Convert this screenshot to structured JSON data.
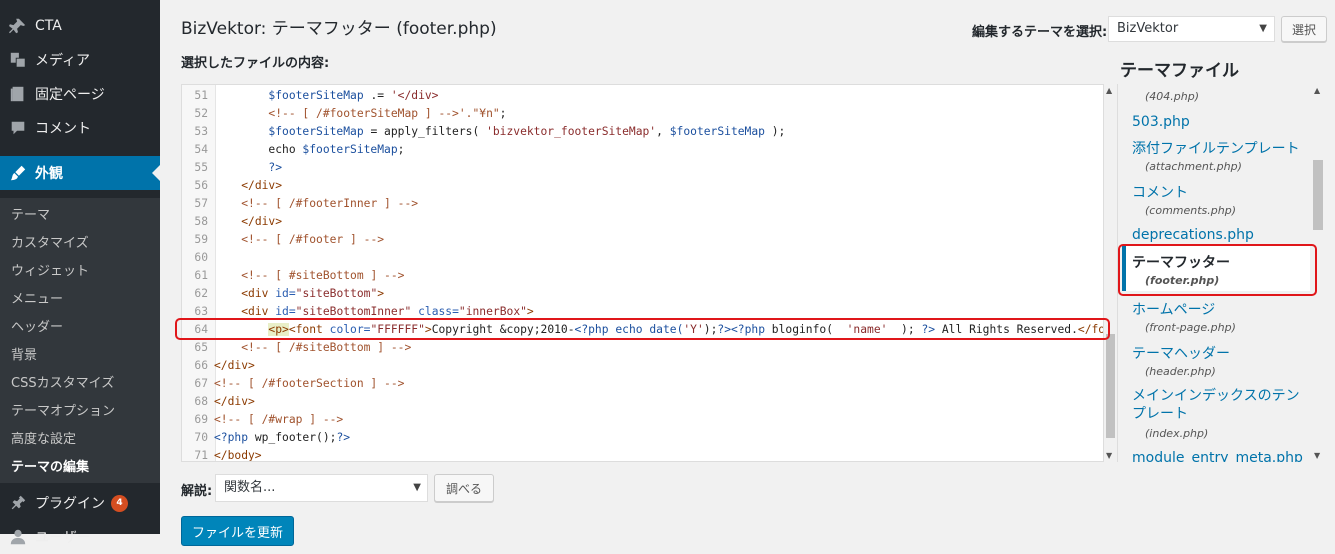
{
  "sidebar": {
    "items": [
      {
        "label": "CTA",
        "icon": "pin-icon"
      },
      {
        "label": "メディア",
        "icon": "media-icon"
      },
      {
        "label": "固定ページ",
        "icon": "page-icon"
      },
      {
        "label": "コメント",
        "icon": "comment-icon"
      },
      {
        "label": "外観",
        "icon": "appearance-icon"
      }
    ],
    "submenu": [
      "テーマ",
      "カスタマイズ",
      "ウィジェット",
      "メニュー",
      "ヘッダー",
      "背景",
      "CSSカスタマイズ",
      "テーマオプション",
      "高度な設定",
      "テーマの編集"
    ],
    "plugins": {
      "label": "プラグイン",
      "badge": "4",
      "icon": "plugin-icon"
    },
    "partial": "ユーザー"
  },
  "header": {
    "title": "BizVektor: テーマフッター (footer.php)",
    "content_label": "選択したファイルの内容:",
    "theme_select_label": "編集するテーマを選択:",
    "theme_select_value": "BizVektor",
    "select_button": "選択"
  },
  "editor": {
    "lines": [
      {
        "n": "51",
        "html": "        <span class=\"v\">$footerSiteMap</span> .= <span class=\"s\">'&lt;/div&gt;</span>"
      },
      {
        "n": "52",
        "html": "        <span class=\"c\">&lt;!-- [ /#footerSiteMap ] --&gt;'.\"¥n\"</span>;"
      },
      {
        "n": "53",
        "html": "        <span class=\"v\">$footerSiteMap</span> = apply_filters( <span class=\"s\">'bizvektor_footerSiteMap'</span>, <span class=\"v\">$footerSiteMap</span> );"
      },
      {
        "n": "54",
        "html": "        echo <span class=\"v\">$footerSiteMap</span>;"
      },
      {
        "n": "55",
        "html": "        <span class=\"p\">?&gt;</span>"
      },
      {
        "n": "56",
        "html": "    <span class=\"t\">&lt;/div&gt;</span>"
      },
      {
        "n": "57",
        "html": "    <span class=\"c\">&lt;!-- [ /#footerInner ] --&gt;</span>"
      },
      {
        "n": "58",
        "html": "    <span class=\"t\">&lt;/div&gt;</span>"
      },
      {
        "n": "59",
        "html": "    <span class=\"c\">&lt;!-- [ /#footer ] --&gt;</span>"
      },
      {
        "n": "60",
        "html": ""
      },
      {
        "n": "61",
        "html": "    <span class=\"c\">&lt;!-- [ #siteBottom ] --&gt;</span>"
      },
      {
        "n": "62",
        "html": "    <span class=\"t\">&lt;div</span> <span class=\"a\">id=</span><span class=\"s\">\"siteBottom\"</span><span class=\"t\">&gt;</span>"
      },
      {
        "n": "63",
        "html": "    <span class=\"t\">&lt;div</span> <span class=\"a\">id=</span><span class=\"s\">\"siteBottomInner\"</span> <span class=\"a\">class=</span><span class=\"s\">\"innerBox\"</span><span class=\"t\">&gt;</span>"
      },
      {
        "n": "64",
        "html": "        <span class=\"t hl-p\">&lt;p&gt;</span><span class=\"t\">&lt;font</span> <span class=\"a\">color=</span><span class=\"s\">\"FFFFFF\"</span><span class=\"t\">&gt;</span>Copyright &amp;copy;2010-<span class=\"p\">&lt;?php</span> <span class=\"v\">echo date(</span><span class=\"s\">'Y'</span>);<span class=\"p\">?&gt;&lt;?php</span> bloginfo(  <span class=\"s\">'name'</span>  ); <span class=\"p\">?&gt;</span> All Rights Reserved.<span class=\"t\">&lt;/font&gt;</span>"
      },
      {
        "n": "65",
        "html": "    <span class=\"c\">&lt;!-- [ /#siteBottom ] --&gt;</span>"
      },
      {
        "n": "66",
        "html": "<span class=\"t\">&lt;/div&gt;</span>"
      },
      {
        "n": "67",
        "html": "<span class=\"c\">&lt;!-- [ /#footerSection ] --&gt;</span>"
      },
      {
        "n": "68",
        "html": "<span class=\"t\">&lt;/div&gt;</span>"
      },
      {
        "n": "69",
        "html": "<span class=\"c\">&lt;!-- [ /#wrap ] --&gt;</span>"
      },
      {
        "n": "70",
        "html": "<span class=\"p\">&lt;?php</span> wp_footer();<span class=\"p\">?&gt;</span>"
      },
      {
        "n": "71",
        "html": "<span class=\"t\">&lt;/body&gt;</span>"
      }
    ]
  },
  "files": {
    "heading": "テーマファイル",
    "items": [
      {
        "title": "",
        "sub": "(404.php)"
      },
      {
        "title": "503.php",
        "sub": ""
      },
      {
        "title": "添付ファイルテンプレート",
        "sub": "(attachment.php)"
      },
      {
        "title": "コメント",
        "sub": "(comments.php)"
      },
      {
        "title": "deprecations.php",
        "sub": ""
      },
      {
        "title": "テーマフッター",
        "sub": "(footer.php)",
        "selected": true
      },
      {
        "title": "ホームページ",
        "sub": "(front-page.php)"
      },
      {
        "title": "テーマヘッダー",
        "sub": "(header.php)"
      },
      {
        "title": "メインインデックスのテンプレート",
        "sub": "(index.php)"
      },
      {
        "title": "module_entry_meta.php",
        "sub": ""
      }
    ]
  },
  "footer": {
    "doc_label": "解説:",
    "doc_select_placeholder": "関数名...",
    "lookup_button": "調べる",
    "update_button": "ファイルを更新"
  },
  "colors": {
    "accent": "#0073aa",
    "highlight_border": "#e0161a",
    "primary_button": "#0085ba"
  }
}
